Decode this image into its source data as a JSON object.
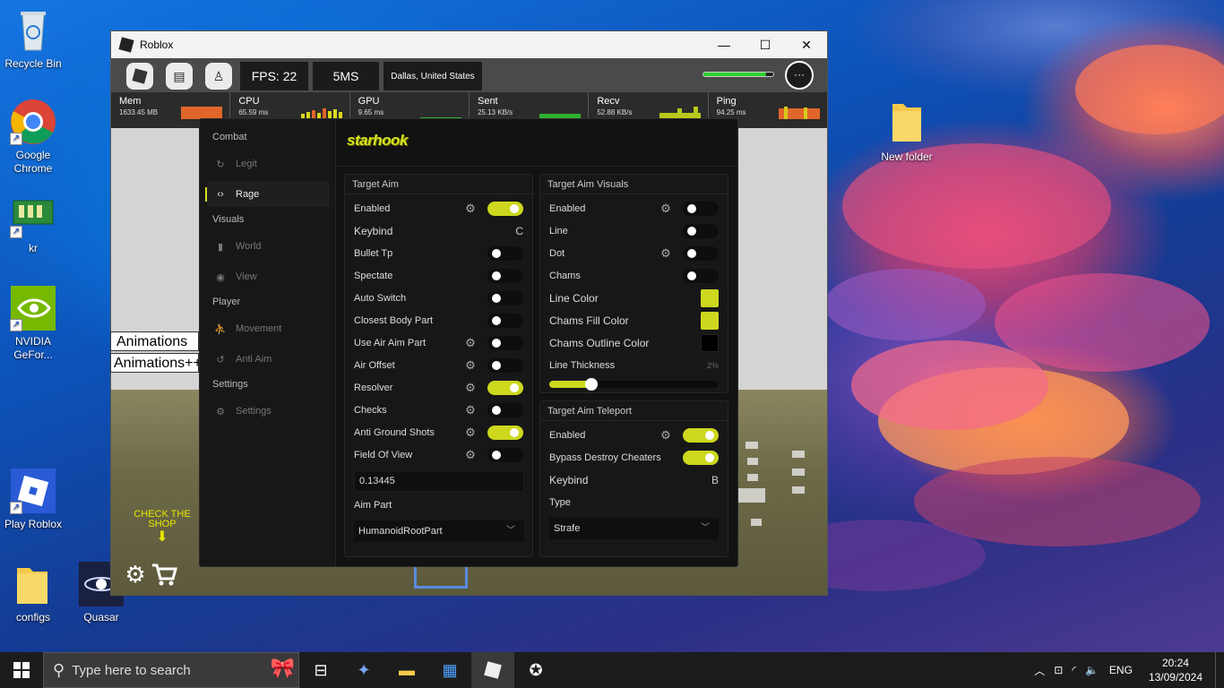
{
  "desktop": {
    "icons": [
      {
        "label": "Recycle Bin"
      },
      {
        "label": "Google Chrome"
      },
      {
        "label": "kr"
      },
      {
        "label": "NVIDIA GeFor..."
      },
      {
        "label": "Play Roblox"
      },
      {
        "label": "configs"
      },
      {
        "label": "Quasar"
      },
      {
        "label": "New folder"
      }
    ]
  },
  "window": {
    "title": "Roblox",
    "minimize": "—",
    "maximize": "☐",
    "close": "✕"
  },
  "topbar": {
    "fps": "FPS: 22",
    "ms": "5MS",
    "server": "Dallas, United States",
    "more": "···"
  },
  "stats": [
    {
      "label": "Mem",
      "value": "1633.45 MB"
    },
    {
      "label": "CPU",
      "value": "65.59 ms"
    },
    {
      "label": "GPU",
      "value": "9.65 ms"
    },
    {
      "label": "Sent",
      "value": "25.13 KB/s"
    },
    {
      "label": "Recv",
      "value": "52.88 KB/s"
    },
    {
      "label": "Ping",
      "value": "94.25 ms"
    }
  ],
  "game_overlay": {
    "animations": "Animations",
    "animations_pp": "Animations++",
    "shop_hint": "CHECK THE SHOP",
    "arrow": "⬇"
  },
  "menu": {
    "logo": "starhook",
    "sidebar": {
      "combat": "Combat",
      "legit": "Legit",
      "rage": "Rage",
      "visuals": "Visuals",
      "world": "World",
      "view": "View",
      "player": "Player",
      "movement": "Movement",
      "anti_aim": "Anti Aim",
      "settings_section": "Settings",
      "settings": "Settings"
    },
    "target_aim": {
      "title": "Target Aim",
      "rows": [
        {
          "label": "Enabled",
          "gear": true,
          "toggle": true
        },
        {
          "label": "Keybind",
          "key": "C"
        },
        {
          "label": "Bullet Tp",
          "toggle": false
        },
        {
          "label": "Spectate",
          "toggle": false
        },
        {
          "label": "Auto Switch",
          "toggle": false
        },
        {
          "label": "Closest Body Part",
          "toggle": false
        },
        {
          "label": "Use Air Aim Part",
          "gear": true,
          "toggle": false
        },
        {
          "label": "Air Offset",
          "gear": true,
          "toggle": false
        },
        {
          "label": "Resolver",
          "gear": true,
          "toggle": true
        },
        {
          "label": "Checks",
          "gear": true,
          "toggle": false
        },
        {
          "label": "Anti Ground Shots",
          "gear": true,
          "toggle": true
        },
        {
          "label": "Field Of View",
          "gear": true,
          "toggle": false
        }
      ],
      "fov_value": "0.13445",
      "aim_part_label": "Aim Part",
      "aim_part_value": "HumanoidRootPart"
    },
    "target_aim_visuals": {
      "title": "Target Aim Visuals",
      "enabled": "Enabled",
      "line": "Line",
      "dot": "Dot",
      "chams": "Chams",
      "line_color": "Line Color",
      "chams_fill_color": "Chams Fill Color",
      "chams_outline_color": "Chams Outline Color",
      "line_thickness": "Line Thickness",
      "line_thickness_value": "2%",
      "line_thickness_fraction": 0.25,
      "colors": {
        "line": "#ccd71e",
        "chams_fill": "#ccd71e",
        "chams_outline": "#000000"
      }
    },
    "target_aim_teleport": {
      "title": "Target Aim Teleport",
      "enabled": "Enabled",
      "bypass": "Bypass Destroy Cheaters",
      "keybind": "Keybind",
      "keybind_value": "B",
      "type_label": "Type",
      "type_value": "Strafe"
    },
    "accent": "#ccd71e"
  },
  "taskbar": {
    "search_placeholder": "Type here to search",
    "lang": "ENG",
    "time": "20:24",
    "date": "13/09/2024"
  }
}
